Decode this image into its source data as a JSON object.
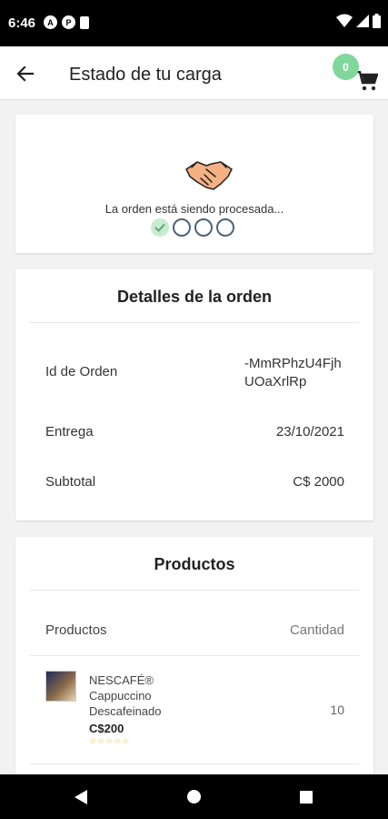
{
  "status_bar": {
    "time": "6:46",
    "left_icons": [
      "A",
      "P"
    ]
  },
  "app_bar": {
    "title": "Estado de tu carga",
    "cart_count": "0"
  },
  "order_status": {
    "message": "La orden está siendo procesada...",
    "steps_completed": 1,
    "steps_total": 4
  },
  "details": {
    "title": "Detalles de la orden",
    "id_label": "Id de Orden",
    "id_value": "-MmRPhzU4FjhUOaXrlRp",
    "delivery_label": "Entrega",
    "delivery_value": "23/10/2021",
    "subtotal_label": "Subtotal",
    "subtotal_value": "C$ 2000"
  },
  "products": {
    "title": "Productos",
    "col_products": "Productos",
    "col_quantity": "Cantidad",
    "items": [
      {
        "name": "NESCAFÉ® Cappuccino Descafeinado",
        "price": "C$200",
        "rating": "☆☆☆☆☆",
        "quantity": "10"
      }
    ]
  },
  "colors": {
    "badge": "#7fd79c",
    "step_done": "#c8ebd2",
    "step_outline": "#4a6378"
  }
}
